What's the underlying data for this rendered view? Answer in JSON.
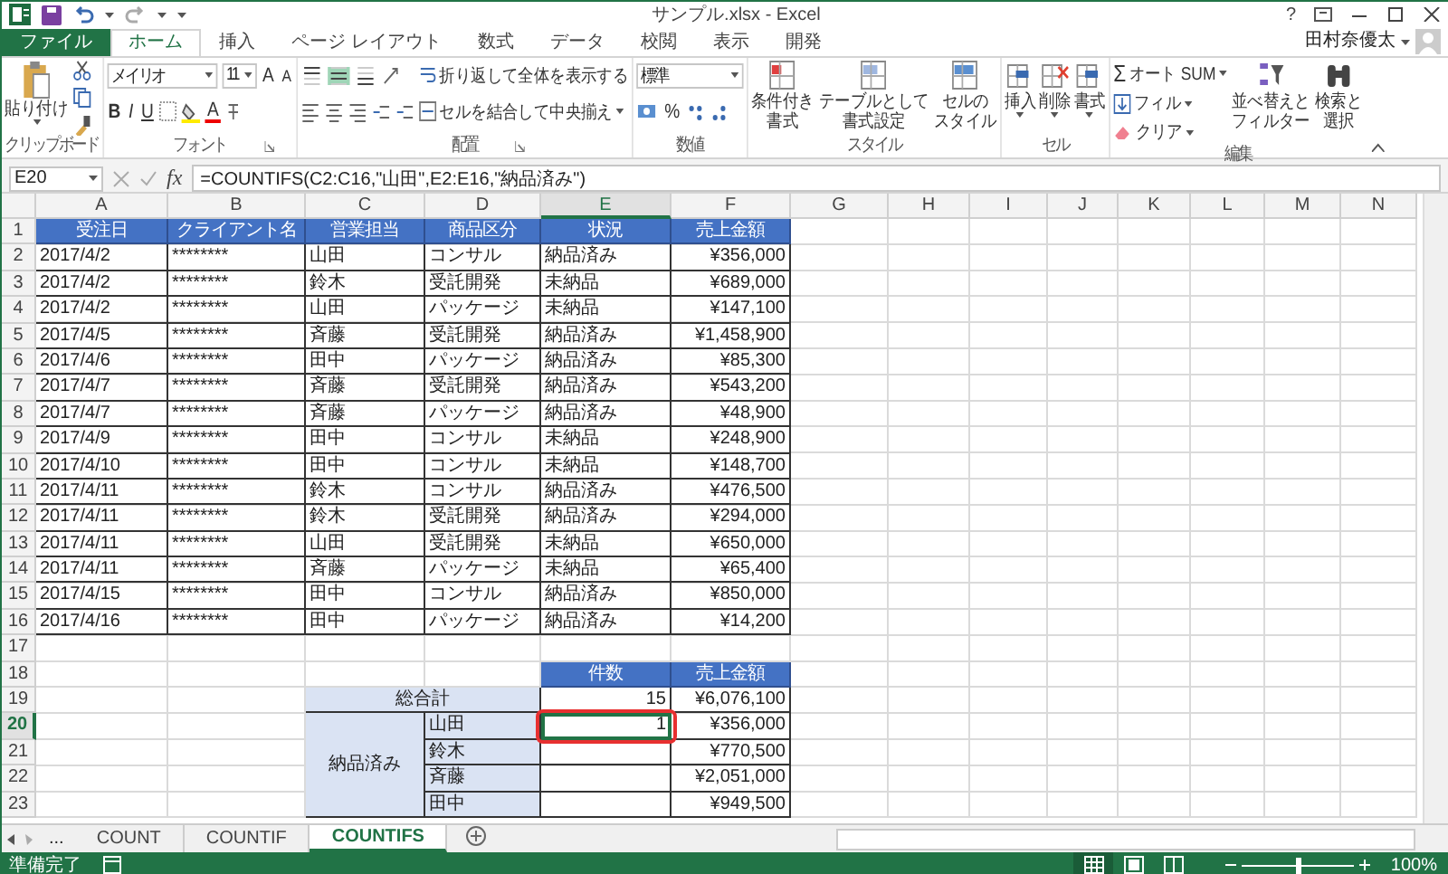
{
  "title_bar": {
    "title": "サンプル.xlsx - Excel",
    "help": "?",
    "user": "田村奈優太"
  },
  "ribbon_tabs": [
    {
      "label": "ファイル",
      "kind": "file",
      "selected": false
    },
    {
      "label": "ホーム",
      "kind": "tab",
      "selected": true
    },
    {
      "label": "挿入",
      "kind": "tab",
      "selected": false
    },
    {
      "label": "ページ レイアウト",
      "kind": "tab",
      "selected": false
    },
    {
      "label": "数式",
      "kind": "tab",
      "selected": false
    },
    {
      "label": "データ",
      "kind": "tab",
      "selected": false
    },
    {
      "label": "校閲",
      "kind": "tab",
      "selected": false
    },
    {
      "label": "表示",
      "kind": "tab",
      "selected": false
    },
    {
      "label": "開発",
      "kind": "tab",
      "selected": false
    }
  ],
  "ribbon": {
    "clipboard": {
      "paste": "貼り付け",
      "label": "クリップボード"
    },
    "font": {
      "name": "メイリオ",
      "size": "11",
      "grow": "A",
      "shrink": "A",
      "bold": "B",
      "italic": "I",
      "underline": "U",
      "font_color": "A",
      "label": "フォント"
    },
    "alignment": {
      "vertical": [
        {
          "selected": false
        },
        {
          "selected": true
        },
        {
          "selected": false
        }
      ],
      "wrap": "折り返して全体を表示する",
      "merge": "セルを結合して中央揃え",
      "label": "配置"
    },
    "number": {
      "format": "標準",
      "percent": "%",
      "label": "数値"
    },
    "styles": {
      "buttons": [
        {
          "lines": [
            "条件付き",
            "書式"
          ]
        },
        {
          "lines": [
            "テーブルとして",
            "書式設定"
          ]
        },
        {
          "lines": [
            "セルの",
            "スタイル"
          ]
        }
      ],
      "label": "スタイル"
    },
    "cells": {
      "buttons": [
        "挿入",
        "削除",
        "書式"
      ],
      "label": "セル"
    },
    "editing": {
      "sigma": "Σ",
      "autosum": "オート SUM",
      "fill": "フィル",
      "clear": "クリア",
      "sort": [
        "並べ替えと",
        "フィルター"
      ],
      "find": [
        "検索と",
        "選択"
      ],
      "label": "編集"
    }
  },
  "formula_bar": {
    "name_box": "E20",
    "fx": "fx",
    "formula": "=COUNTIFS(C2:C16,\"山田\",E2:E16,\"納品済み\")"
  },
  "sheet": {
    "columns": [
      {
        "label": "A",
        "selected": false
      },
      {
        "label": "B",
        "selected": false
      },
      {
        "label": "C",
        "selected": false
      },
      {
        "label": "D",
        "selected": false
      },
      {
        "label": "E",
        "selected": true
      },
      {
        "label": "F",
        "selected": false
      },
      {
        "label": "G",
        "selected": false
      },
      {
        "label": "H",
        "selected": false
      },
      {
        "label": "I",
        "selected": false
      },
      {
        "label": "J",
        "selected": false
      },
      {
        "label": "K",
        "selected": false
      },
      {
        "label": "L",
        "selected": false
      },
      {
        "label": "M",
        "selected": false
      },
      {
        "label": "N",
        "selected": false
      }
    ],
    "rows": [
      {
        "label": "1",
        "selected": false
      },
      {
        "label": "2",
        "selected": false
      },
      {
        "label": "3",
        "selected": false
      },
      {
        "label": "4",
        "selected": false
      },
      {
        "label": "5",
        "selected": false
      },
      {
        "label": "6",
        "selected": false
      },
      {
        "label": "7",
        "selected": false
      },
      {
        "label": "8",
        "selected": false
      },
      {
        "label": "9",
        "selected": false
      },
      {
        "label": "10",
        "selected": false
      },
      {
        "label": "11",
        "selected": false
      },
      {
        "label": "12",
        "selected": false
      },
      {
        "label": "13",
        "selected": false
      },
      {
        "label": "14",
        "selected": false
      },
      {
        "label": "15",
        "selected": false
      },
      {
        "label": "16",
        "selected": false
      },
      {
        "label": "17",
        "selected": false
      },
      {
        "label": "18",
        "selected": false
      },
      {
        "label": "19",
        "selected": false
      },
      {
        "label": "20",
        "selected": true
      },
      {
        "label": "21",
        "selected": false
      },
      {
        "label": "22",
        "selected": false
      },
      {
        "label": "23",
        "selected": false
      }
    ],
    "data_table": {
      "columns": [
        "受注日",
        "クライアント名",
        "営業担当",
        "商品区分",
        "状況",
        "売上金額"
      ],
      "rows": [
        [
          "2017/4/2",
          "********",
          "山田",
          "コンサル",
          "納品済み",
          "¥356,000"
        ],
        [
          "2017/4/2",
          "********",
          "鈴木",
          "受託開発",
          "未納品",
          "¥689,000"
        ],
        [
          "2017/4/2",
          "********",
          "山田",
          "パッケージ",
          "未納品",
          "¥147,100"
        ],
        [
          "2017/4/5",
          "********",
          "斉藤",
          "受託開発",
          "納品済み",
          "¥1,458,900"
        ],
        [
          "2017/4/6",
          "********",
          "田中",
          "パッケージ",
          "納品済み",
          "¥85,300"
        ],
        [
          "2017/4/7",
          "********",
          "斉藤",
          "受託開発",
          "納品済み",
          "¥543,200"
        ],
        [
          "2017/4/7",
          "********",
          "斉藤",
          "パッケージ",
          "納品済み",
          "¥48,900"
        ],
        [
          "2017/4/9",
          "********",
          "田中",
          "コンサル",
          "未納品",
          "¥248,900"
        ],
        [
          "2017/4/10",
          "********",
          "田中",
          "コンサル",
          "未納品",
          "¥148,700"
        ],
        [
          "2017/4/11",
          "********",
          "鈴木",
          "コンサル",
          "納品済み",
          "¥476,500"
        ],
        [
          "2017/4/11",
          "********",
          "鈴木",
          "受託開発",
          "納品済み",
          "¥294,000"
        ],
        [
          "2017/4/11",
          "********",
          "山田",
          "受託開発",
          "未納品",
          "¥650,000"
        ],
        [
          "2017/4/11",
          "********",
          "斉藤",
          "パッケージ",
          "未納品",
          "¥65,400"
        ],
        [
          "2017/4/15",
          "********",
          "田中",
          "コンサル",
          "納品済み",
          "¥850,000"
        ],
        [
          "2017/4/16",
          "********",
          "田中",
          "パッケージ",
          "納品済み",
          "¥14,200"
        ]
      ]
    },
    "summary": {
      "headers": [
        "件数",
        "売上金額"
      ],
      "total": {
        "label": "総合計",
        "count": "15",
        "amount": "¥6,076,100"
      },
      "group": {
        "label": "納品済み",
        "rows": [
          {
            "name": "山田",
            "count": "1",
            "amount": "¥356,000",
            "selected": true,
            "circled": true
          },
          {
            "name": "鈴木",
            "amount": "¥770,500",
            "selected": false,
            "circled": false
          },
          {
            "name": "斉藤",
            "amount": "¥2,051,000",
            "selected": false,
            "circled": false
          },
          {
            "name": "田中",
            "amount": "¥949,500",
            "selected": false,
            "circled": false
          }
        ]
      }
    }
  },
  "sheet_tabs": {
    "more": "...",
    "tabs": [
      {
        "label": "COUNT",
        "selected": false
      },
      {
        "label": "COUNTIF",
        "selected": false
      },
      {
        "label": "COUNTIFS",
        "selected": true
      }
    ]
  },
  "status_bar": {
    "status": "準備完了",
    "views": [
      {
        "kind": "normal",
        "selected": true
      },
      {
        "kind": "page_layout",
        "selected": false
      },
      {
        "kind": "page_break",
        "selected": false
      }
    ],
    "zoom": {
      "level": 0.5,
      "reading": "100%"
    }
  }
}
